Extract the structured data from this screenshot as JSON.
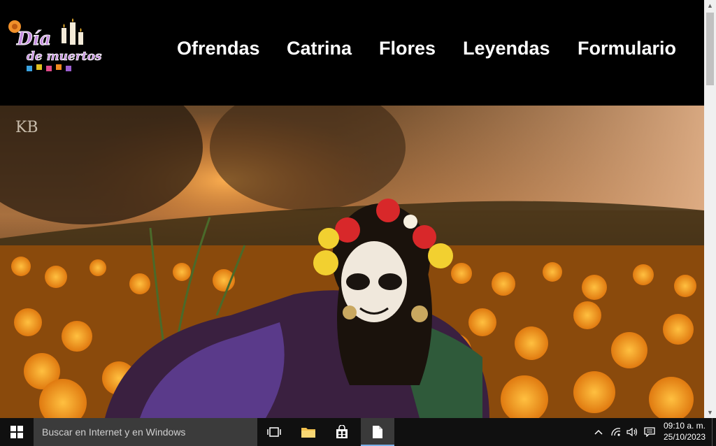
{
  "header": {
    "logo_text_line1": "Día",
    "logo_text_line2": "de muertos"
  },
  "nav": {
    "items": [
      "Ofrendas",
      "Catrina",
      "Flores",
      "Leyendas",
      "Formulario"
    ]
  },
  "hero": {
    "watermark": "KB",
    "alt": "Catrina entre flores de cempasúchil"
  },
  "taskbar": {
    "search_placeholder": "Buscar en Internet y en Windows",
    "time": "09:10 a. m.",
    "date": "25/10/2023"
  },
  "colors": {
    "header_bg": "#000000",
    "nav_text": "#ffffff",
    "marigold": "#f29a1c",
    "taskbar_bg": "#101010"
  }
}
